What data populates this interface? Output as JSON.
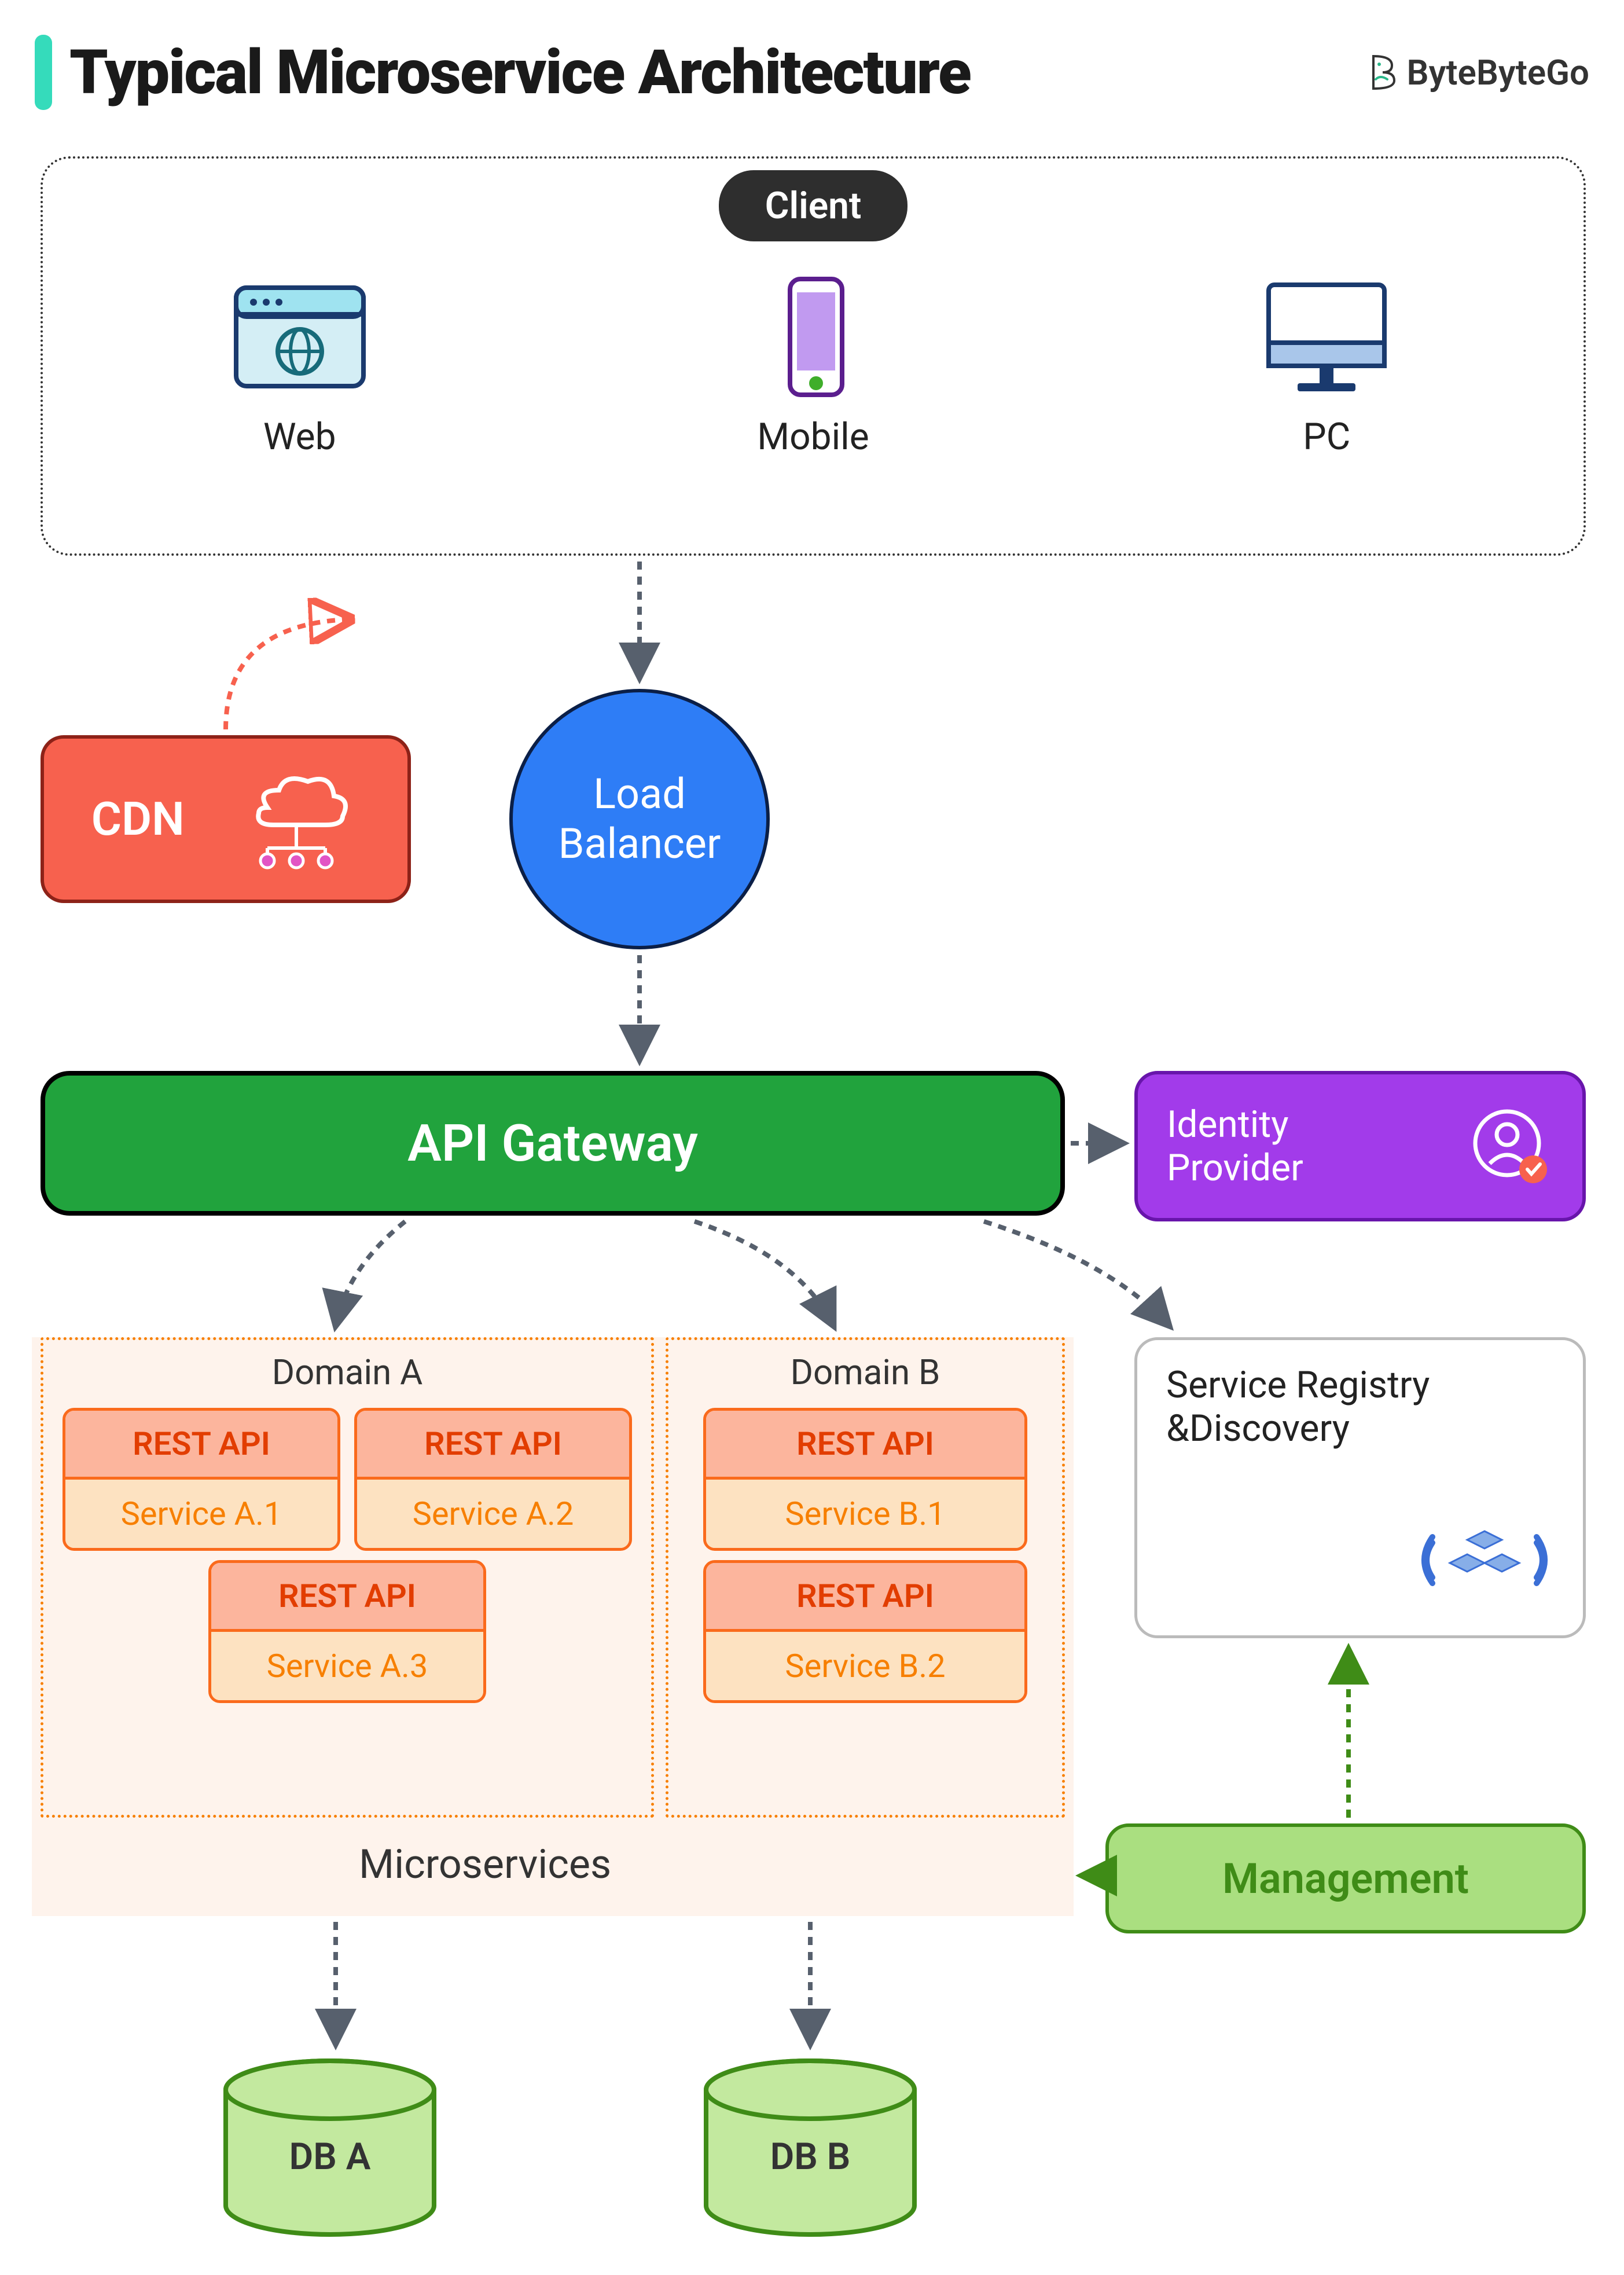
{
  "title": "Typical Microservice Architecture",
  "brand": "ByteByteGo",
  "client": {
    "label": "Client",
    "items": [
      "Web",
      "Mobile",
      "PC"
    ]
  },
  "cdn": {
    "label": "CDN"
  },
  "load_balancer": {
    "label": "Load\nBalancer"
  },
  "api_gateway": {
    "label": "API Gateway"
  },
  "identity_provider": {
    "label": "Identity\nProvider"
  },
  "microservices": {
    "label": "Microservices",
    "domains": [
      {
        "name": "Domain A",
        "services": [
          {
            "api": "REST API",
            "name": "Service A.1"
          },
          {
            "api": "REST API",
            "name": "Service A.2"
          },
          {
            "api": "REST API",
            "name": "Service A.3"
          }
        ]
      },
      {
        "name": "Domain B",
        "services": [
          {
            "api": "REST API",
            "name": "Service B.1"
          },
          {
            "api": "REST API",
            "name": "Service B.2"
          }
        ]
      }
    ]
  },
  "service_registry": {
    "label": "Service Registry\n&Discovery"
  },
  "management": {
    "label": "Management"
  },
  "databases": [
    "DB A",
    "DB B"
  ]
}
